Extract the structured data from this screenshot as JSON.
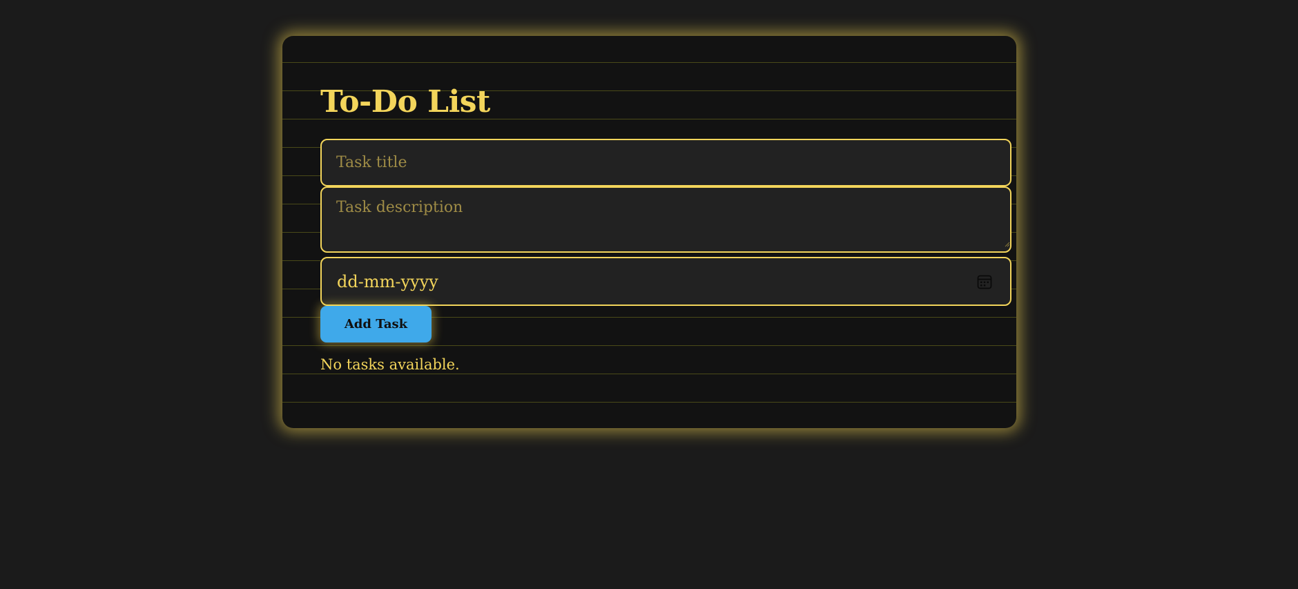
{
  "app": {
    "title": "To-Do List"
  },
  "form": {
    "title_placeholder": "Task title",
    "description_placeholder": "Task description",
    "date_value": "dd-mm-yyyy",
    "add_button_label": "Add Task"
  },
  "tasks": {
    "empty_message": "No tasks available."
  },
  "icons": {
    "date": "calendar-icon"
  },
  "colors": {
    "accent": "#f3d55b",
    "button": "#3fa9ea",
    "background": "#1b1b1b",
    "card": "#121212",
    "field": "#222222"
  }
}
